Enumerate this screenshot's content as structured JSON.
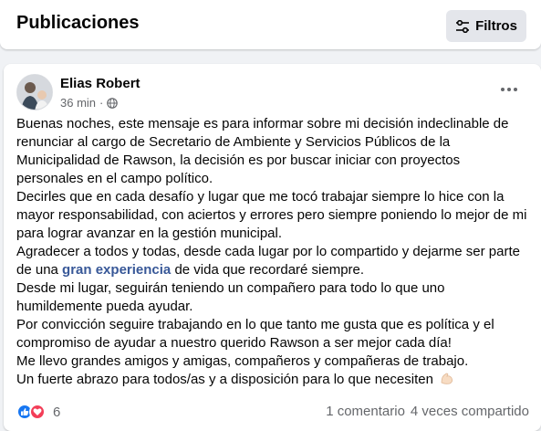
{
  "header": {
    "title": "Publicaciones",
    "filter_label": "Filtros"
  },
  "post": {
    "author": "Elias Robert",
    "time": "36 min",
    "separator": "·",
    "paragraphs": [
      "Buenas noches, este mensaje es para informar sobre mi decisión indeclinable de renunciar al cargo de Secretario de Ambiente y Servicios Públicos de la Municipalidad de Rawson, la decisión es por buscar iniciar con proyectos personales en el campo político.",
      "Decirles que en cada desafío y lugar que me tocó trabajar siempre lo hice con la mayor responsabilidad, con aciertos y errores pero siempre poniendo lo mejor de mi para lograr avanzar en  la gestión municipal."
    ],
    "p3_before": "Agradecer a todos y todas, desde cada lugar por lo compartido y dejarme ser parte de una ",
    "p3_link": "gran experiencia",
    "p3_after": " de vida que recordaré siempre.",
    "paragraphs_after": [
      "Desde mi lugar, seguirán teniendo un compañero para todo lo que uno humildemente pueda ayudar.",
      "Por convicción seguire trabajando en lo que tanto me gusta que es política y el compromiso de ayudar a nuestro querido Rawson a ser mejor cada día!",
      "Me llevo grandes amigos y amigas, compañeros y compañeras de trabajo."
    ],
    "closing": "Un fuerte abrazo para todos/as y a disposición para lo que necesiten",
    "reaction_count": "6",
    "comments": "1 comentario",
    "shares": "4 veces compartido"
  },
  "colors": {
    "accent": "#1877f2",
    "love": "#f33e58",
    "link": "#385898",
    "secondary_text": "#65676b"
  },
  "icons": {
    "filter": "sliders-icon",
    "privacy": "globe-icon",
    "more": "more-options-icon",
    "like": "like-reaction-icon",
    "love": "love-reaction-icon",
    "emoji": "flexed-biceps-emoji-icon"
  }
}
